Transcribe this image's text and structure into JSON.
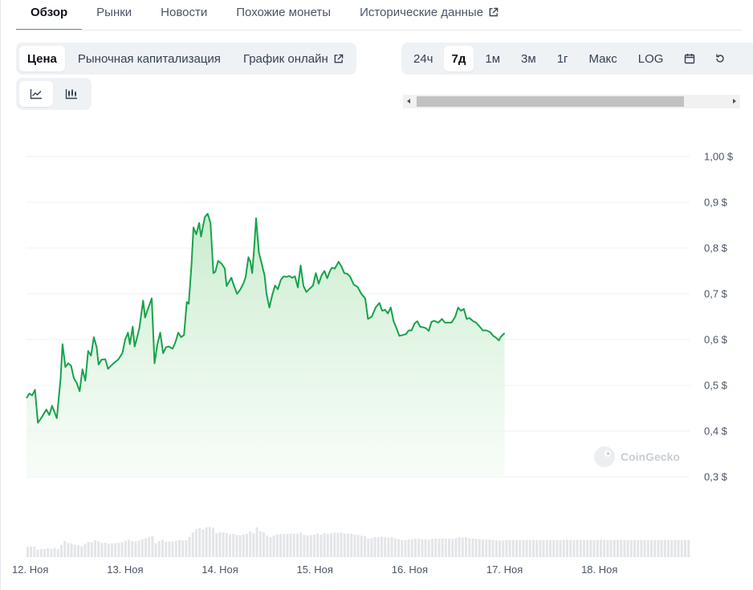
{
  "nav": {
    "tabs": [
      {
        "label": "Обзор",
        "active": true
      },
      {
        "label": "Рынки",
        "active": false
      },
      {
        "label": "Новости",
        "active": false
      },
      {
        "label": "Похожие монеты",
        "active": false
      },
      {
        "label": "Исторические данные",
        "active": false,
        "icon": "external-link-icon"
      }
    ]
  },
  "chart_type_tabs": [
    {
      "label": "Цена",
      "active": true
    },
    {
      "label": "Рыночная капитализация",
      "active": false
    },
    {
      "label": "График онлайн",
      "active": false,
      "icon": "external-link-icon"
    }
  ],
  "chart_view_buttons": [
    {
      "icon": "line-chart-icon",
      "active": true
    },
    {
      "icon": "candlestick-chart-icon",
      "active": false
    }
  ],
  "range_tabs": [
    {
      "label": "24ч",
      "active": false
    },
    {
      "label": "7д",
      "active": true
    },
    {
      "label": "1м",
      "active": false
    },
    {
      "label": "3м",
      "active": false
    },
    {
      "label": "1г",
      "active": false
    },
    {
      "label": "Макс",
      "active": false
    },
    {
      "label": "LOG",
      "active": false
    }
  ],
  "range_icons": [
    "calendar-icon",
    "reset-icon"
  ],
  "watermark": "CoinGecko",
  "colors": {
    "accent": "#4caf50",
    "line": "#16a34a",
    "fill": "#dcf3df",
    "volume": "#e3e5e8"
  },
  "chart_data": {
    "type": "area",
    "title": "",
    "xlabel": "",
    "ylabel": "",
    "ylim": [
      0.3,
      1.0
    ],
    "grid": true,
    "y_ticks": [
      "1,00 $",
      "0,9 $",
      "0,8 $",
      "0,7 $",
      "0,6 $",
      "0,5 $",
      "0,4 $",
      "0,3 $"
    ],
    "y_tick_values": [
      1.0,
      0.9,
      0.8,
      0.7,
      0.6,
      0.5,
      0.4,
      0.3
    ],
    "x_ticks": [
      "12. Ноя",
      "13. Ноя",
      "14. Ноя",
      "15. Ноя",
      "16. Ноя",
      "17. Ноя",
      "18. Ноя"
    ],
    "x_range_days": [
      11.96,
      18.95
    ],
    "series": [
      {
        "values": [
          [
            11.96,
            0.472
          ],
          [
            11.99,
            0.482
          ],
          [
            12.02,
            0.478
          ],
          [
            12.05,
            0.49
          ],
          [
            12.08,
            0.418
          ],
          [
            12.12,
            0.43
          ],
          [
            12.17,
            0.447
          ],
          [
            12.2,
            0.435
          ],
          [
            12.23,
            0.455
          ],
          [
            12.28,
            0.428
          ],
          [
            12.32,
            0.515
          ],
          [
            12.34,
            0.59
          ],
          [
            12.37,
            0.54
          ],
          [
            12.4,
            0.548
          ],
          [
            12.43,
            0.543
          ],
          [
            12.46,
            0.515
          ],
          [
            12.49,
            0.505
          ],
          [
            12.52,
            0.487
          ],
          [
            12.55,
            0.535
          ],
          [
            12.58,
            0.51
          ],
          [
            12.61,
            0.575
          ],
          [
            12.64,
            0.565
          ],
          [
            12.67,
            0.605
          ],
          [
            12.7,
            0.583
          ],
          [
            12.72,
            0.545
          ],
          [
            12.75,
            0.556
          ],
          [
            12.79,
            0.557
          ],
          [
            12.82,
            0.536
          ],
          [
            12.85,
            0.543
          ],
          [
            12.89,
            0.55
          ],
          [
            12.93,
            0.557
          ],
          [
            12.97,
            0.57
          ],
          [
            13.0,
            0.6
          ],
          [
            13.03,
            0.615
          ],
          [
            13.05,
            0.59
          ],
          [
            13.08,
            0.628
          ],
          [
            13.1,
            0.585
          ],
          [
            13.12,
            0.6
          ],
          [
            13.15,
            0.625
          ],
          [
            13.19,
            0.685
          ],
          [
            13.21,
            0.648
          ],
          [
            13.24,
            0.667
          ],
          [
            13.28,
            0.69
          ],
          [
            13.31,
            0.548
          ],
          [
            13.34,
            0.59
          ],
          [
            13.37,
            0.615
          ],
          [
            13.4,
            0.57
          ],
          [
            13.43,
            0.583
          ],
          [
            13.46,
            0.585
          ],
          [
            13.5,
            0.58
          ],
          [
            13.53,
            0.594
          ],
          [
            13.56,
            0.615
          ],
          [
            13.59,
            0.605
          ],
          [
            13.62,
            0.61
          ],
          [
            13.65,
            0.682
          ],
          [
            13.67,
            0.678
          ],
          [
            13.7,
            0.765
          ],
          [
            13.72,
            0.845
          ],
          [
            13.75,
            0.83
          ],
          [
            13.78,
            0.855
          ],
          [
            13.8,
            0.825
          ],
          [
            13.84,
            0.868
          ],
          [
            13.87,
            0.875
          ],
          [
            13.9,
            0.855
          ],
          [
            13.93,
            0.745
          ],
          [
            13.95,
            0.748
          ],
          [
            13.98,
            0.772
          ],
          [
            14.02,
            0.765
          ],
          [
            14.05,
            0.755
          ],
          [
            14.07,
            0.717
          ],
          [
            14.1,
            0.728
          ],
          [
            14.12,
            0.735
          ],
          [
            14.15,
            0.716
          ],
          [
            14.18,
            0.7
          ],
          [
            14.21,
            0.708
          ],
          [
            14.25,
            0.724
          ],
          [
            14.27,
            0.737
          ],
          [
            14.3,
            0.78
          ],
          [
            14.32,
            0.77
          ],
          [
            14.34,
            0.745
          ],
          [
            14.36,
            0.8
          ],
          [
            14.38,
            0.865
          ],
          [
            14.41,
            0.79
          ],
          [
            14.44,
            0.765
          ],
          [
            14.47,
            0.74
          ],
          [
            14.49,
            0.7
          ],
          [
            14.52,
            0.67
          ],
          [
            14.55,
            0.697
          ],
          [
            14.58,
            0.718
          ],
          [
            14.61,
            0.71
          ],
          [
            14.64,
            0.73
          ],
          [
            14.67,
            0.738
          ],
          [
            14.7,
            0.737
          ],
          [
            14.73,
            0.739
          ],
          [
            14.76,
            0.735
          ],
          [
            14.79,
            0.738
          ],
          [
            14.82,
            0.714
          ],
          [
            14.85,
            0.762
          ],
          [
            14.88,
            0.717
          ],
          [
            14.91,
            0.704
          ],
          [
            14.95,
            0.712
          ],
          [
            14.98,
            0.718
          ],
          [
            15.01,
            0.745
          ],
          [
            15.04,
            0.722
          ],
          [
            15.07,
            0.74
          ],
          [
            15.1,
            0.75
          ],
          [
            15.13,
            0.734
          ],
          [
            15.16,
            0.75
          ],
          [
            15.18,
            0.757
          ],
          [
            15.21,
            0.755
          ],
          [
            15.25,
            0.77
          ],
          [
            15.28,
            0.76
          ],
          [
            15.31,
            0.745
          ],
          [
            15.34,
            0.744
          ],
          [
            15.37,
            0.738
          ],
          [
            15.41,
            0.72
          ],
          [
            15.45,
            0.715
          ],
          [
            15.49,
            0.7
          ],
          [
            15.53,
            0.69
          ],
          [
            15.56,
            0.645
          ],
          [
            15.6,
            0.65
          ],
          [
            15.64,
            0.67
          ],
          [
            15.68,
            0.68
          ],
          [
            15.71,
            0.663
          ],
          [
            15.74,
            0.665
          ],
          [
            15.77,
            0.657
          ],
          [
            15.8,
            0.67
          ],
          [
            15.83,
            0.64
          ],
          [
            15.86,
            0.625
          ],
          [
            15.89,
            0.608
          ],
          [
            15.93,
            0.61
          ],
          [
            15.96,
            0.612
          ],
          [
            15.99,
            0.62
          ],
          [
            16.02,
            0.62
          ],
          [
            16.05,
            0.635
          ],
          [
            16.08,
            0.64
          ],
          [
            16.11,
            0.628
          ],
          [
            16.14,
            0.627
          ],
          [
            16.17,
            0.625
          ],
          [
            16.2,
            0.619
          ],
          [
            16.23,
            0.639
          ],
          [
            16.26,
            0.641
          ],
          [
            16.3,
            0.637
          ],
          [
            16.34,
            0.645
          ],
          [
            16.37,
            0.637
          ],
          [
            16.4,
            0.637
          ],
          [
            16.44,
            0.637
          ],
          [
            16.48,
            0.65
          ],
          [
            16.51,
            0.67
          ],
          [
            16.54,
            0.663
          ],
          [
            16.57,
            0.667
          ],
          [
            16.6,
            0.645
          ],
          [
            16.63,
            0.647
          ],
          [
            16.67,
            0.64
          ],
          [
            16.7,
            0.637
          ],
          [
            16.73,
            0.63
          ],
          [
            16.77,
            0.62
          ],
          [
            16.81,
            0.62
          ],
          [
            16.85,
            0.616
          ],
          [
            16.88,
            0.608
          ],
          [
            16.91,
            0.604
          ],
          [
            16.94,
            0.598
          ],
          [
            16.96,
            0.606
          ],
          [
            17.0,
            0.614
          ]
        ]
      }
    ]
  }
}
